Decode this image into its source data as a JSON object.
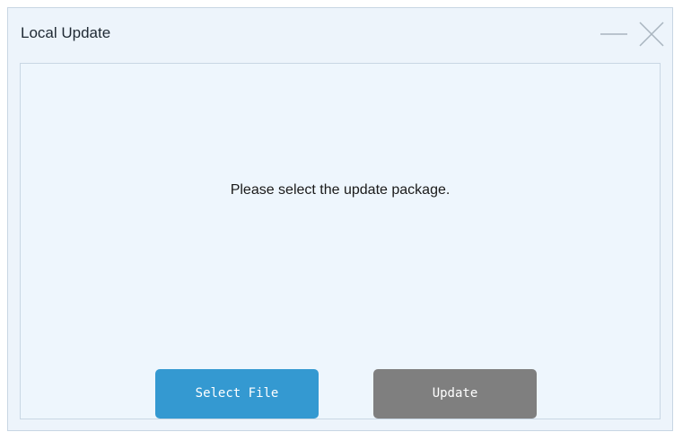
{
  "window": {
    "title": "Local Update"
  },
  "content": {
    "message": "Please select the update package."
  },
  "buttons": {
    "select_file": "Select File",
    "update": "Update"
  },
  "colors": {
    "select_file_bg": "#3499d1",
    "update_bg": "#7f7f7f",
    "window_bg": "#edf4fb"
  },
  "icons": {
    "minimize": "minimize-icon",
    "close": "close-icon"
  }
}
